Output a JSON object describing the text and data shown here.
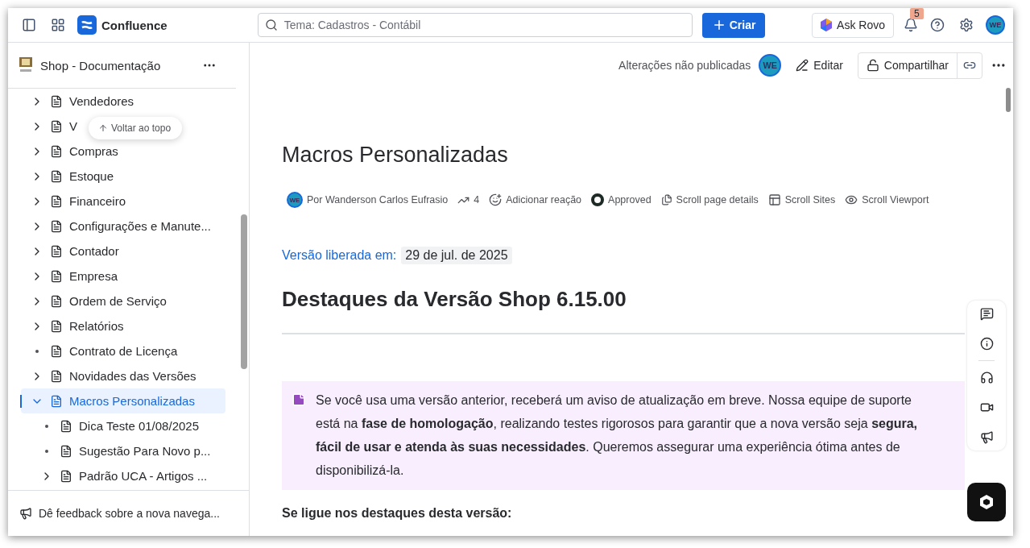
{
  "topbar": {
    "product": "Confluence",
    "search": {
      "placeholder": "Tema: Cadastros - Contábil"
    },
    "create_button": "Criar",
    "ask_button": "Ask Rovo",
    "notifications_badge": "5",
    "avatar": "WE"
  },
  "sidebar": {
    "space_title": "Shop - Documentação",
    "back_to_top": "Voltar ao topo",
    "items": [
      {
        "label": "Vendedores",
        "kind": "folder",
        "expanded": false,
        "selected": false
      },
      {
        "label": "V",
        "kind": "folder",
        "expanded": false,
        "selected": false
      },
      {
        "label": "Compras",
        "kind": "folder",
        "expanded": false,
        "selected": false
      },
      {
        "label": "Estoque",
        "kind": "folder",
        "expanded": false,
        "selected": false
      },
      {
        "label": "Financeiro",
        "kind": "folder",
        "expanded": false,
        "selected": false
      },
      {
        "label": "Configurações e Manute...",
        "kind": "folder",
        "expanded": false,
        "selected": false
      },
      {
        "label": "Contador",
        "kind": "folder",
        "expanded": false,
        "selected": false
      },
      {
        "label": "Empresa",
        "kind": "folder",
        "expanded": false,
        "selected": false
      },
      {
        "label": "Ordem de Serviço",
        "kind": "folder",
        "expanded": false,
        "selected": false
      },
      {
        "label": "Relatórios",
        "kind": "folder",
        "expanded": false,
        "selected": false
      },
      {
        "label": "Contrato de Licença",
        "kind": "leaf",
        "selected": false
      },
      {
        "label": "Novidades das Versões",
        "kind": "folder",
        "expanded": false,
        "selected": false
      },
      {
        "label": "Macros Personalizadas",
        "kind": "folder",
        "expanded": true,
        "selected": true,
        "children": [
          {
            "label": "Dica Teste 01/08/2025",
            "kind": "leaf",
            "selected": false
          },
          {
            "label": "Sugestão Para Novo p...",
            "kind": "leaf",
            "selected": false
          },
          {
            "label": "Padrão UCA - Artigos ...",
            "kind": "folder",
            "expanded": false,
            "selected": false
          }
        ]
      }
    ],
    "feedback": "Dê feedback sobre a nova navega..."
  },
  "page_toolbar": {
    "status": "Alterações não publicadas",
    "avatar": "WE",
    "edit": "Editar",
    "share": "Compartilhar"
  },
  "page": {
    "title": "Macros Personalizadas",
    "byline": [
      {
        "kind": "author",
        "text": "Por Wanderson Carlos Eufrasio",
        "avatar": "WE"
      },
      {
        "kind": "views",
        "text": "4"
      },
      {
        "kind": "reaction",
        "text": "Adicionar reação"
      },
      {
        "kind": "status",
        "text": "Approved"
      },
      {
        "kind": "details",
        "text": "Scroll page details"
      },
      {
        "kind": "sites",
        "text": "Scroll Sites"
      },
      {
        "kind": "viewport",
        "text": "Scroll Viewport"
      }
    ],
    "release_label": "Versão liberada em:",
    "release_date": "29 de jul. de 2025",
    "heading": "Destaques da Versão Shop 6.15.00",
    "note": "Se você usa uma versão anterior, receberá um aviso de atualização em breve. Nossa equipe de suporte está na **fase de homologação**, realizando testes rigorosos para garantir que a nova versão seja **segura, fácil de usar e atenda às suas necessidades**. Queremos assegurar uma experiência ótima antes de disponibilizá-la.",
    "subheading": "Se ligue nos destaques desta versão:"
  }
}
